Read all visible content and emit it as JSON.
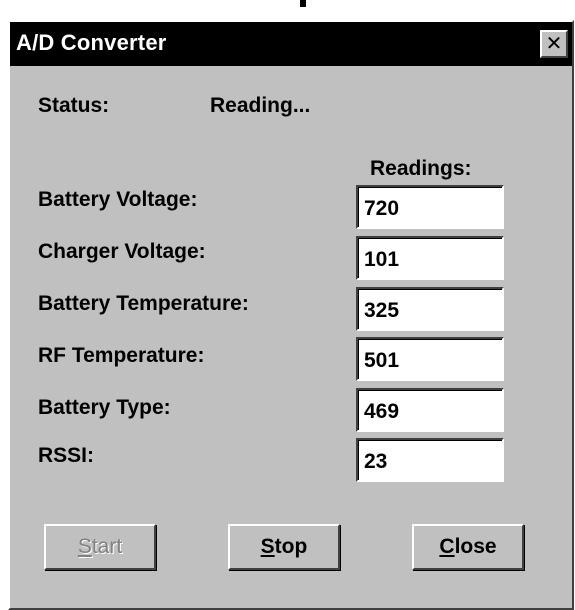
{
  "window": {
    "title": "A/D Converter",
    "close_glyph": "✕"
  },
  "status": {
    "label": "Status:",
    "value": "Reading..."
  },
  "readings_header": "Readings:",
  "readings": [
    {
      "label": "Battery Voltage:",
      "value": "720"
    },
    {
      "label": "Charger Voltage:",
      "value": "101"
    },
    {
      "label": "Battery Temperature:",
      "value": "325"
    },
    {
      "label": "RF Temperature:",
      "value": "501"
    },
    {
      "label": "Battery Type:",
      "value": "469"
    },
    {
      "label": "RSSI:",
      "value": "23"
    }
  ],
  "buttons": {
    "start": {
      "accel": "S",
      "rest": "tart",
      "enabled": false
    },
    "stop": {
      "accel": "S",
      "rest": "top",
      "enabled": true
    },
    "close": {
      "accel": "C",
      "rest": "lose",
      "enabled": true
    }
  },
  "colors": {
    "face": "#c0c0c0",
    "titlebar": "#000000",
    "highlight": "#ffffff",
    "shadow": "#404040",
    "disabled_text": "#808080"
  }
}
